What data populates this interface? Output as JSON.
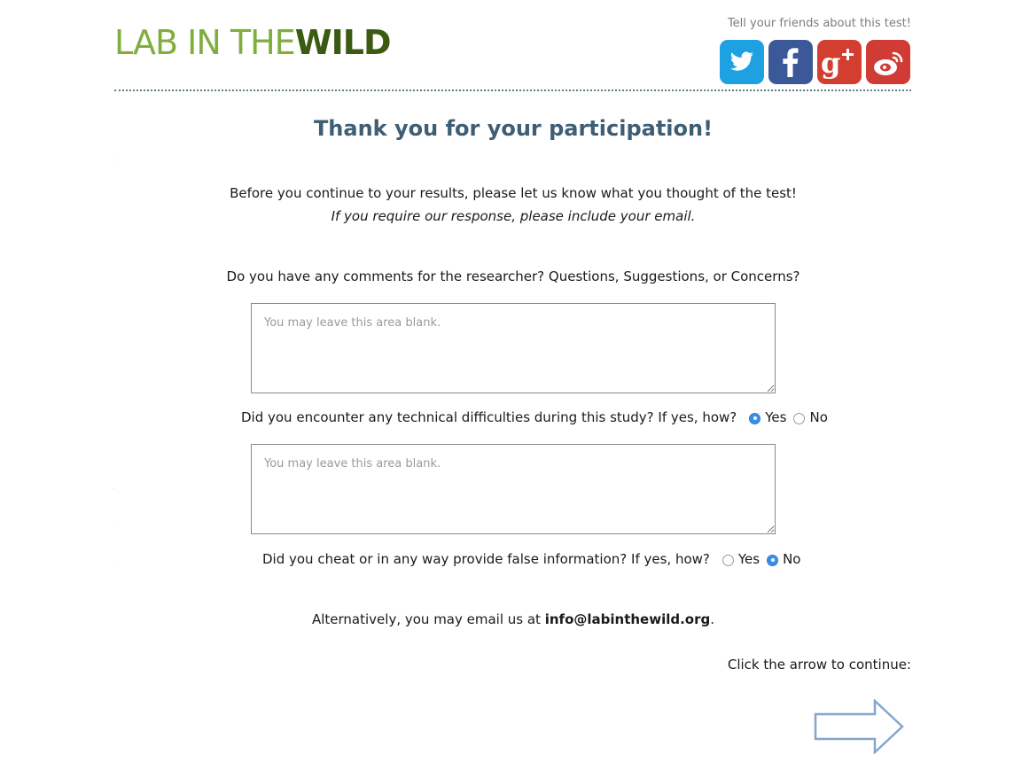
{
  "header": {
    "logo_part1": "LAB IN THE",
    "logo_part2": "WILD",
    "share_text": "Tell your friends about this test!",
    "social": [
      {
        "name": "twitter-icon",
        "color": "#1da1e2"
      },
      {
        "name": "facebook-icon",
        "color": "#3b5998"
      },
      {
        "name": "google-plus-icon",
        "color": "#d23f31"
      },
      {
        "name": "weibo-icon",
        "color": "#d03c35"
      }
    ]
  },
  "main": {
    "title": "Thank you for your participation!",
    "intro": "Before you continue to your results, please let us know what you thought of the test!",
    "intro_italic": "If you require our response, please include your email.",
    "q1": {
      "label": "Do you have any comments for the researcher? Questions, Suggestions, or Concerns?",
      "placeholder": "You may leave this area blank."
    },
    "q2": {
      "label": "Did you encounter any technical difficulties during this study? If yes, how?",
      "yes": "Yes",
      "no": "No",
      "selected": "Yes",
      "placeholder": "You may leave this area blank."
    },
    "q3": {
      "label": "Did you cheat or in any way provide false information? If yes, how?",
      "yes": "Yes",
      "no": "No",
      "selected": "No"
    },
    "email_prefix": "Alternatively, you may email us at ",
    "email": "info@labinthewild.org",
    "email_suffix": ".",
    "continue_text": "Click the arrow to continue:"
  }
}
